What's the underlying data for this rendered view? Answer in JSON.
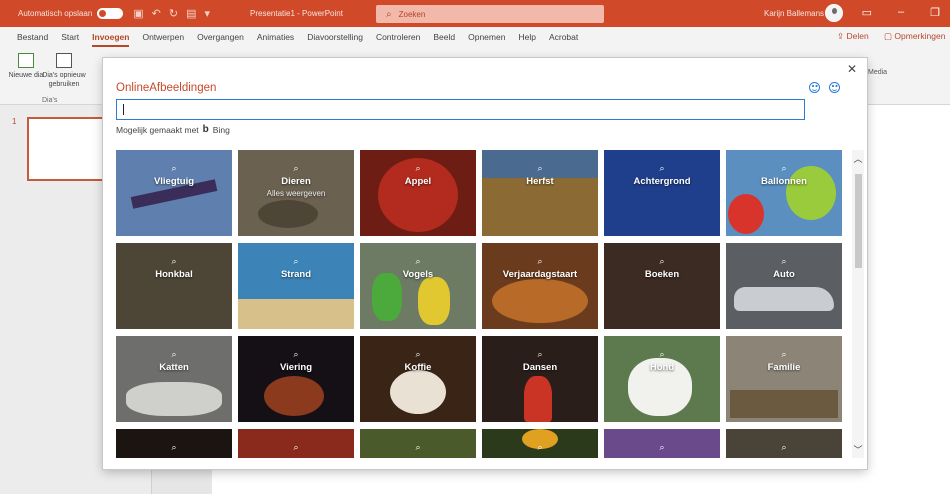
{
  "titlebar": {
    "autosave_label": "Automatisch opslaan",
    "autosave_state": "on",
    "doc_title": "Presentatie1 - PowerPoint",
    "search_placeholder": "Zoeken",
    "user_name": "Karijn Ballemans",
    "accent_color": "#d04a29"
  },
  "ribbon": {
    "tabs": [
      "Bestand",
      "Start",
      "Invoegen",
      "Ontwerpen",
      "Overgangen",
      "Animaties",
      "Diavoorstelling",
      "Controleren",
      "Beeld",
      "Opnemen",
      "Help",
      "Acrobat"
    ],
    "active_tab": "Invoegen",
    "share_label": "Delen",
    "comments_label": "Opmerkingen",
    "new_slide_label": "Nieuwe dia",
    "reuse_label": "Dia's opnieuw gebruiken",
    "group_label": "Dia's",
    "media_label": "Media"
  },
  "slides": {
    "current_number": "1"
  },
  "dialog": {
    "title": "OnlineAfbeeldingen",
    "search_value": "",
    "powered_by": "Mogelijk gemaakt met",
    "bing_label": "Bing",
    "tiles": [
      {
        "label": "Vliegtuig",
        "sub": ""
      },
      {
        "label": "Dieren",
        "sub": "Alles weergeven"
      },
      {
        "label": "Appel",
        "sub": ""
      },
      {
        "label": "Herfst",
        "sub": ""
      },
      {
        "label": "Achtergrond",
        "sub": ""
      },
      {
        "label": "Ballonnen",
        "sub": ""
      },
      {
        "label": "Honkbal",
        "sub": ""
      },
      {
        "label": "Strand",
        "sub": ""
      },
      {
        "label": "Vogels",
        "sub": ""
      },
      {
        "label": "Verjaardagstaart",
        "sub": ""
      },
      {
        "label": "Boeken",
        "sub": ""
      },
      {
        "label": "Auto",
        "sub": ""
      },
      {
        "label": "Katten",
        "sub": ""
      },
      {
        "label": "Viering",
        "sub": ""
      },
      {
        "label": "Koffie",
        "sub": ""
      },
      {
        "label": "Dansen",
        "sub": ""
      },
      {
        "label": "Hond",
        "sub": ""
      },
      {
        "label": "Familie",
        "sub": ""
      },
      {
        "label": "",
        "sub": ""
      },
      {
        "label": "",
        "sub": ""
      },
      {
        "label": "",
        "sub": ""
      },
      {
        "label": "",
        "sub": ""
      },
      {
        "label": "",
        "sub": ""
      },
      {
        "label": "",
        "sub": ""
      }
    ]
  }
}
